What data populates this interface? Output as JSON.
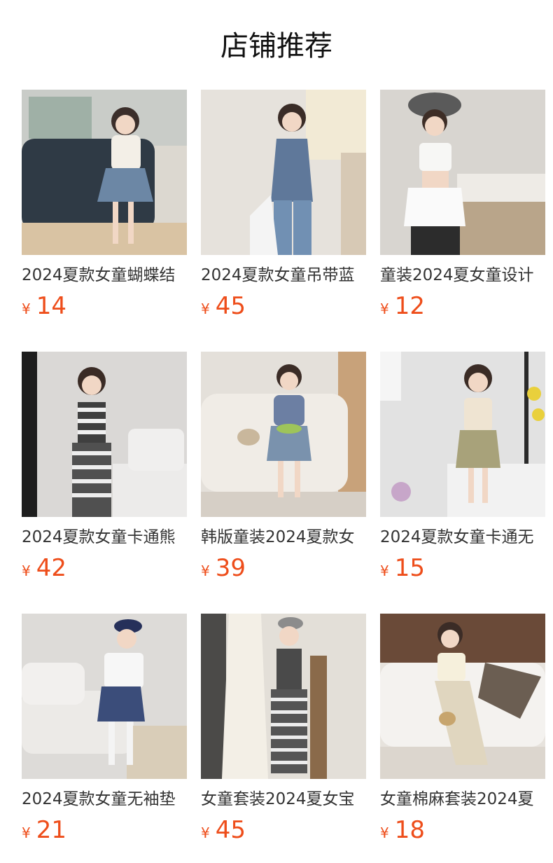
{
  "section": {
    "title": "店铺推荐"
  },
  "currency_symbol": "¥",
  "price_color": "#ee4d1a",
  "products": [
    {
      "title": "2024夏款女童蝴蝶结",
      "price": "14",
      "image": "girl-white-tee-denim-skirt-photo"
    },
    {
      "title": "2024夏款女童吊带蓝",
      "price": "45",
      "image": "girl-denim-halter-top-photo"
    },
    {
      "title": "童装2024夏女童设计",
      "price": "12",
      "image": "girl-white-crop-top-beret-photo"
    },
    {
      "title": "2024夏款女童卡通熊",
      "price": "42",
      "image": "girl-striped-set-photo"
    },
    {
      "title": "韩版童装2024夏款女",
      "price": "39",
      "image": "girl-plaid-top-denim-skirt-photo"
    },
    {
      "title": "2024夏款女童卡通无",
      "price": "15",
      "image": "girl-cartoon-tank-khaki-skirt-photo"
    },
    {
      "title": "2024夏款女童无袖垫",
      "price": "21",
      "image": "girl-white-tee-plaid-shorts-photo"
    },
    {
      "title": "女童套装2024夏女宝",
      "price": "45",
      "image": "girl-striped-jumpsuit-photo"
    },
    {
      "title": "女童棉麻套装2024夏",
      "price": "18",
      "image": "girl-linen-set-photo"
    }
  ]
}
